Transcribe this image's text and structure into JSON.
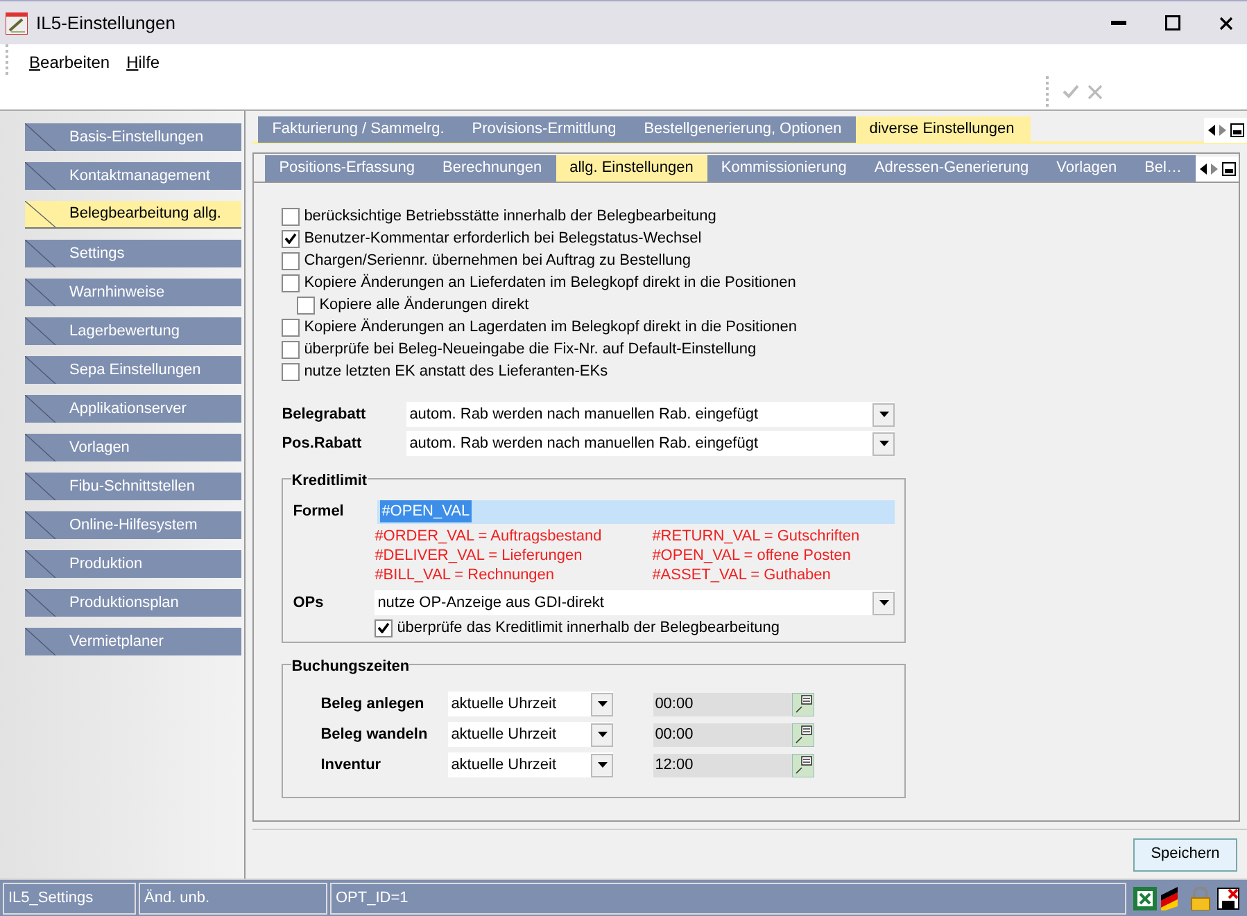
{
  "window": {
    "title": "IL5-Einstellungen"
  },
  "menu": [
    {
      "label": "Bearbeiten"
    },
    {
      "label": "Hilfe"
    }
  ],
  "sidebar": {
    "items": [
      {
        "label": "Basis-Einstellungen",
        "selected": false
      },
      {
        "label": "Kontaktmanagement",
        "selected": false
      },
      {
        "label": "Belegbearbeitung allg.",
        "selected": true
      },
      {
        "label": "Settings",
        "selected": false
      },
      {
        "label": "Warnhinweise",
        "selected": false
      },
      {
        "label": "Lagerbewertung",
        "selected": false
      },
      {
        "label": "Sepa Einstellungen",
        "selected": false
      },
      {
        "label": "Applikationserver",
        "selected": false
      },
      {
        "label": "Vorlagen",
        "selected": false
      },
      {
        "label": "Fibu-Schnittstellen",
        "selected": false
      },
      {
        "label": "Online-Hilfesystem",
        "selected": false
      },
      {
        "label": "Produktion",
        "selected": false
      },
      {
        "label": "Produktionsplan",
        "selected": false
      },
      {
        "label": "Vermietplaner",
        "selected": false
      }
    ]
  },
  "tabs": [
    {
      "label": "Fakturierung / Sammelrg.",
      "selected": false
    },
    {
      "label": "Provisions-Ermittlung",
      "selected": false
    },
    {
      "label": "Bestellgenerierung, Optionen",
      "selected": false
    },
    {
      "label": "diverse Einstellungen",
      "selected": true
    }
  ],
  "subtabs": [
    {
      "label": "Positions-Erfassung",
      "selected": false
    },
    {
      "label": "Berechnungen",
      "selected": false
    },
    {
      "label": "allg. Einstellungen",
      "selected": true
    },
    {
      "label": "Kommissionierung",
      "selected": false
    },
    {
      "label": "Adressen-Generierung",
      "selected": false
    },
    {
      "label": "Vorlagen",
      "selected": false
    },
    {
      "label": "Bel…",
      "selected": false
    }
  ],
  "options": [
    {
      "label": "berücksichtige Betriebsstätte innerhalb der Belegbearbeitung",
      "checked": false
    },
    {
      "label": "Benutzer-Kommentar erforderlich bei Belegstatus-Wechsel",
      "checked": true
    },
    {
      "label": "Chargen/Seriennr. übernehmen bei Auftrag zu Bestellung",
      "checked": false
    },
    {
      "label": "Kopiere Änderungen an Lieferdaten im Belegkopf direkt in die Positionen",
      "checked": false,
      "children": [
        {
          "label": "Kopiere alle Änderungen direkt",
          "checked": false
        }
      ]
    },
    {
      "label": "Kopiere Änderungen an Lagerdaten im Belegkopf direkt in die Positionen",
      "checked": false
    },
    {
      "label": "überprüfe bei Beleg-Neueingabe die Fix-Nr. auf Default-Einstellung",
      "checked": false
    },
    {
      "label": "nutze letzten EK anstatt des Lieferanten-EKs",
      "checked": false
    }
  ],
  "discounts": [
    {
      "label": "Belegrabatt",
      "value": "autom. Rab werden nach manuellen Rab. eingefügt"
    },
    {
      "label": "Pos.Rabatt",
      "value": "autom. Rab werden nach manuellen Rab. eingefügt"
    }
  ],
  "credit_limit": {
    "title": "Kreditlimit",
    "formula_label": "Formel",
    "formula_value": "#OPEN_VAL",
    "legend": [
      "#ORDER_VAL = Auftragsbestand",
      "#RETURN_VAL = Gutschriften",
      "#DELIVER_VAL = Lieferungen",
      "#OPEN_VAL = offene Posten",
      "#BILL_VAL = Rechnungen",
      "#ASSET_VAL = Guthaben"
    ],
    "ops_label": "OPs",
    "ops_value": "nutze OP-Anzeige aus GDI-direkt",
    "check": {
      "label": "überprüfe das Kreditlimit innerhalb der Belegbearbeitung",
      "checked": true
    }
  },
  "booking_times": {
    "title": "Buchungszeiten",
    "rows": [
      {
        "label": "Beleg anlegen",
        "mode": "aktuelle Uhrzeit",
        "time": "00:00"
      },
      {
        "label": "Beleg wandeln",
        "mode": "aktuelle Uhrzeit",
        "time": "00:00"
      },
      {
        "label": "Inventur",
        "mode": "aktuelle Uhrzeit",
        "time": "12:00"
      }
    ]
  },
  "save_button": "Speichern",
  "status_bar": [
    "IL5_Settings",
    "Änd. unb.",
    "OPT_ID=1"
  ]
}
